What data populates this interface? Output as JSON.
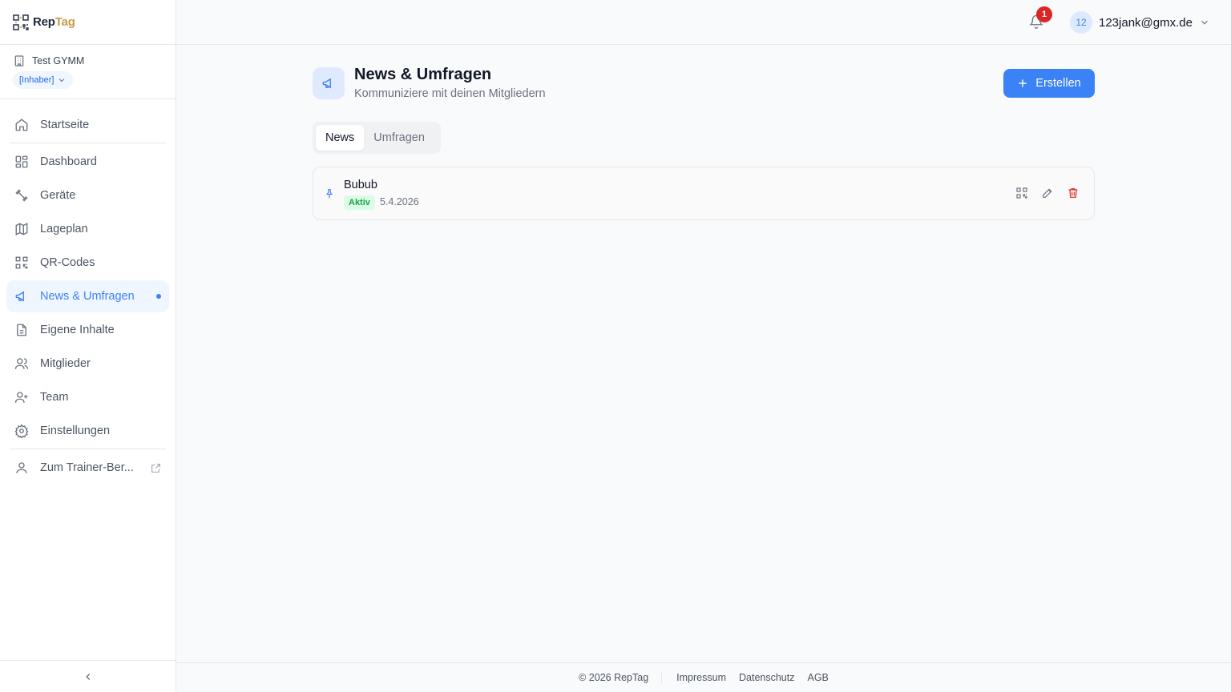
{
  "brand": {
    "name_rep": "Rep",
    "name_tag": "Tag"
  },
  "gym": {
    "name": "Test GYMM",
    "role": "[Inhaber]"
  },
  "sidebar": {
    "items": [
      {
        "label": "Startseite",
        "icon": "home-icon"
      },
      {
        "label": "Dashboard",
        "icon": "dashboard-icon"
      },
      {
        "label": "Geräte",
        "icon": "dumbbell-icon"
      },
      {
        "label": "Lageplan",
        "icon": "map-icon"
      },
      {
        "label": "QR-Codes",
        "icon": "qr-code-icon"
      },
      {
        "label": "News & Umfragen",
        "icon": "megaphone-icon",
        "active": true
      },
      {
        "label": "Eigene Inhalte",
        "icon": "document-icon"
      },
      {
        "label": "Mitglieder",
        "icon": "users-icon"
      },
      {
        "label": "Team",
        "icon": "user-plus-icon"
      },
      {
        "label": "Einstellungen",
        "icon": "gear-icon"
      },
      {
        "label": "Zum Trainer-Ber...",
        "icon": "user-icon"
      }
    ]
  },
  "header": {
    "notification_count": "1",
    "avatar_initials": "12",
    "email": "123jank@gmx.de"
  },
  "main": {
    "title": "News & Umfragen",
    "subtitle": "Kommuniziere mit deinen Mitgliedern",
    "create_label": "Erstellen",
    "tabs": [
      {
        "label": "News",
        "active": true
      },
      {
        "label": "Umfragen",
        "active": false
      }
    ],
    "news_items": [
      {
        "title": "Bubub",
        "status": "Aktiv",
        "date": "5.4.2026"
      }
    ]
  },
  "footer": {
    "copyright": "© 2026 RepTag",
    "links": [
      "Impressum",
      "Datenschutz",
      "AGB"
    ]
  },
  "colors": {
    "accent": "#3b82f6",
    "danger": "#dc2626",
    "success": "#16a34a",
    "brand_gold": "#c89b4a"
  }
}
